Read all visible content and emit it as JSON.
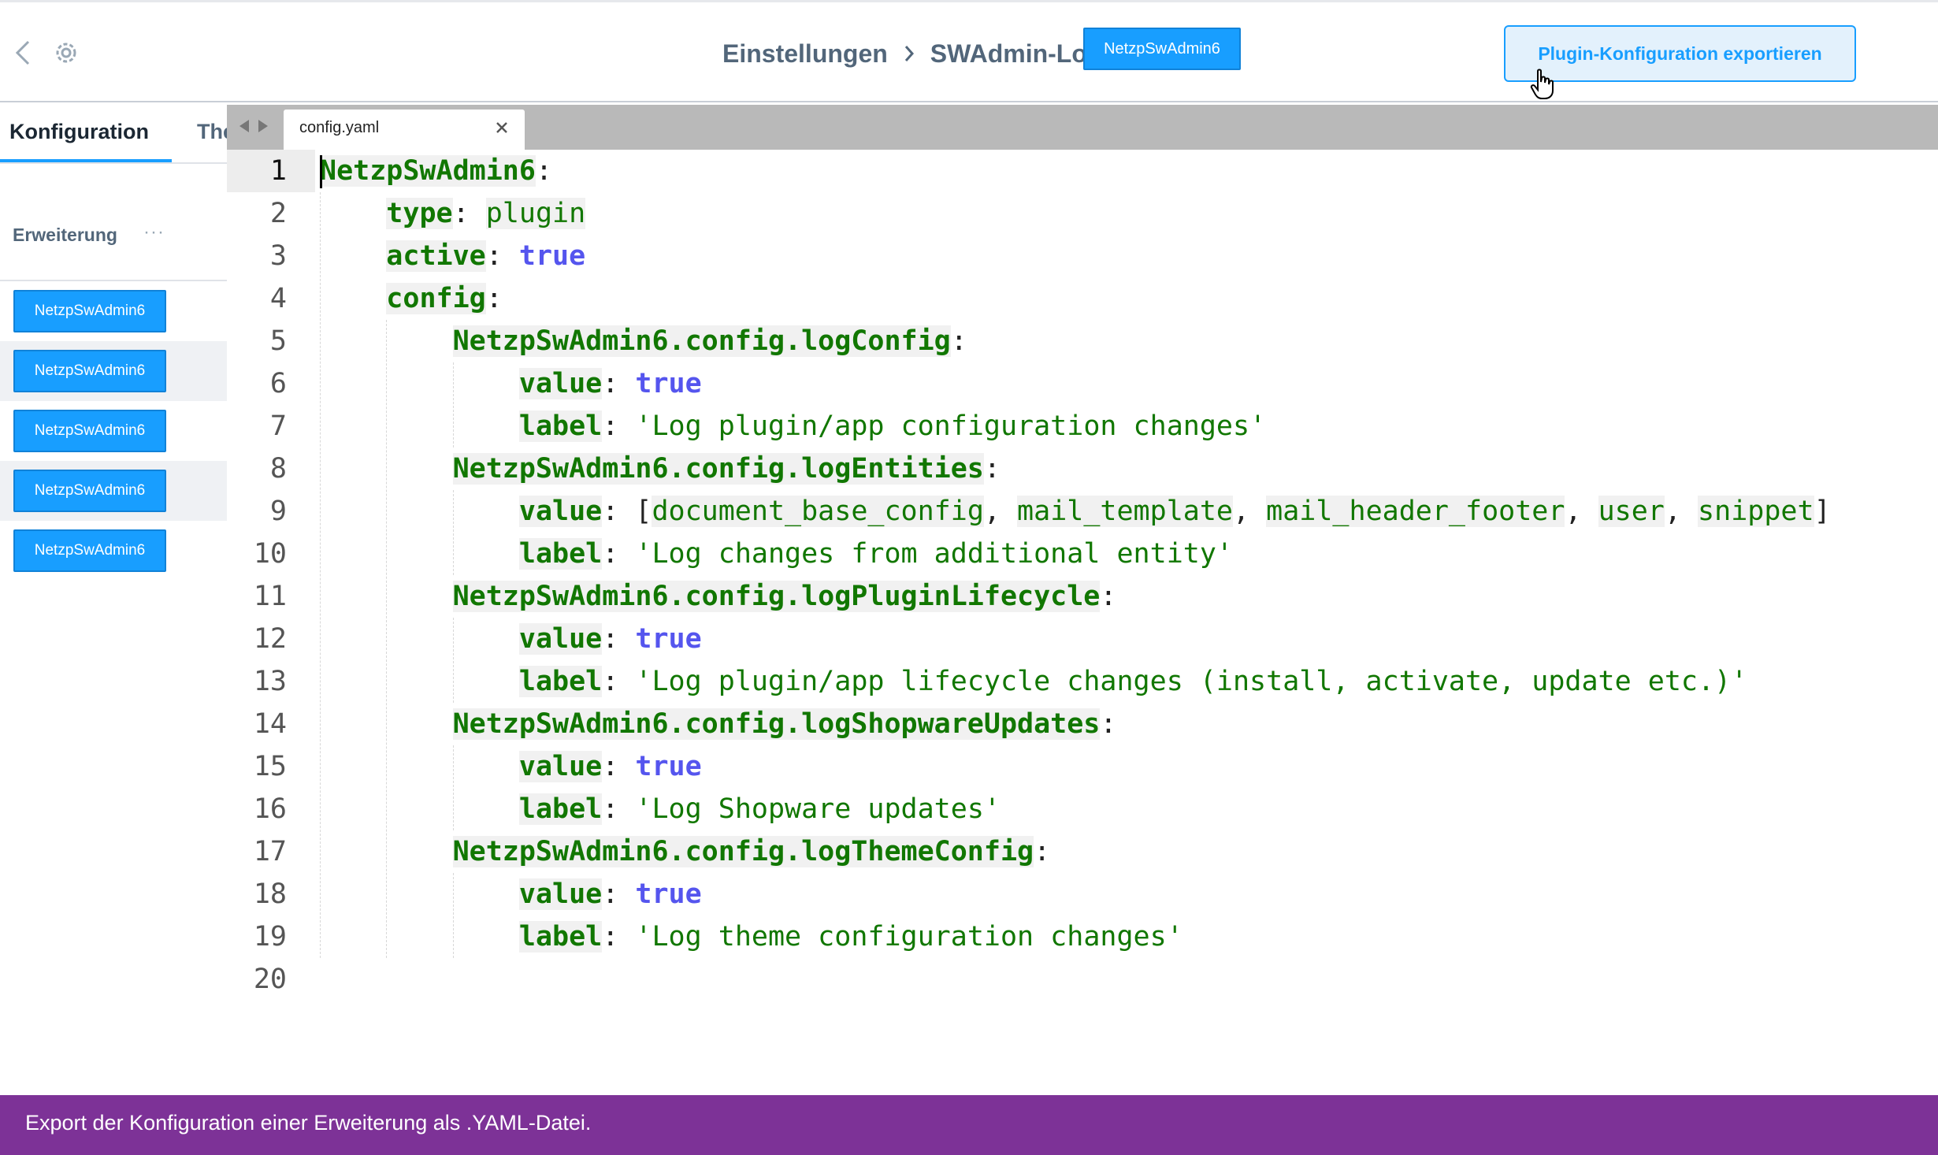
{
  "header": {
    "breadcrumb": [
      "Einstellungen",
      "SWAdmin-Log"
    ],
    "plugin_badge": "NetzpSwAdmin6",
    "export_button": "Plugin-Konfiguration exportieren",
    "accent_color": "#189eff"
  },
  "tabs": [
    {
      "label": "Konfiguration",
      "active": true
    },
    {
      "label": "Theme",
      "active": false
    }
  ],
  "sidebar": {
    "title": "Erweiterung",
    "more": "···",
    "items": [
      "NetzpSwAdmin6",
      "NetzpSwAdmin6",
      "NetzpSwAdmin6",
      "NetzpSwAdmin6",
      "NetzpSwAdmin6"
    ]
  },
  "editor": {
    "file_tab": "config.yaml",
    "close_icon": "close-icon",
    "current_line": 1,
    "line_numbers": [
      "1",
      "2",
      "3",
      "4",
      "5",
      "6",
      "7",
      "8",
      "9",
      "10",
      "11",
      "12",
      "13",
      "14",
      "15",
      "16",
      "17",
      "18",
      "19",
      "20"
    ],
    "lines": [
      [
        {
          "t": "NetzpSwAdmin6",
          "c": "k"
        },
        {
          "t": ":",
          "c": "p"
        }
      ],
      [
        {
          "t": "    ",
          "c": "p"
        },
        {
          "t": "type",
          "c": "k"
        },
        {
          "t": ": ",
          "c": "p"
        },
        {
          "t": "plugin",
          "c": "a"
        }
      ],
      [
        {
          "t": "    ",
          "c": "p"
        },
        {
          "t": "active",
          "c": "k"
        },
        {
          "t": ": ",
          "c": "p"
        },
        {
          "t": "true",
          "c": "b"
        }
      ],
      [
        {
          "t": "    ",
          "c": "p"
        },
        {
          "t": "config",
          "c": "k"
        },
        {
          "t": ":",
          "c": "p"
        }
      ],
      [
        {
          "t": "        ",
          "c": "p"
        },
        {
          "t": "NetzpSwAdmin6.config.logConfig",
          "c": "k"
        },
        {
          "t": ":",
          "c": "p"
        }
      ],
      [
        {
          "t": "            ",
          "c": "p"
        },
        {
          "t": "value",
          "c": "k"
        },
        {
          "t": ": ",
          "c": "p"
        },
        {
          "t": "true",
          "c": "b"
        }
      ],
      [
        {
          "t": "            ",
          "c": "p"
        },
        {
          "t": "label",
          "c": "k"
        },
        {
          "t": ": ",
          "c": "p"
        },
        {
          "t": "'Log plugin/app configuration changes'",
          "c": "s"
        }
      ],
      [
        {
          "t": "        ",
          "c": "p"
        },
        {
          "t": "NetzpSwAdmin6.config.logEntities",
          "c": "k"
        },
        {
          "t": ":",
          "c": "p"
        }
      ],
      [
        {
          "t": "            ",
          "c": "p"
        },
        {
          "t": "value",
          "c": "k"
        },
        {
          "t": ": [",
          "c": "p"
        },
        {
          "t": "document_base_config",
          "c": "a"
        },
        {
          "t": ", ",
          "c": "p"
        },
        {
          "t": "mail_template",
          "c": "a"
        },
        {
          "t": ", ",
          "c": "p"
        },
        {
          "t": "mail_header_footer",
          "c": "a"
        },
        {
          "t": ", ",
          "c": "p"
        },
        {
          "t": "user",
          "c": "a"
        },
        {
          "t": ", ",
          "c": "p"
        },
        {
          "t": "snippet",
          "c": "a"
        },
        {
          "t": "]",
          "c": "p"
        }
      ],
      [
        {
          "t": "            ",
          "c": "p"
        },
        {
          "t": "label",
          "c": "k"
        },
        {
          "t": ": ",
          "c": "p"
        },
        {
          "t": "'Log changes from additional entity'",
          "c": "s"
        }
      ],
      [
        {
          "t": "        ",
          "c": "p"
        },
        {
          "t": "NetzpSwAdmin6.config.logPluginLifecycle",
          "c": "k"
        },
        {
          "t": ":",
          "c": "p"
        }
      ],
      [
        {
          "t": "            ",
          "c": "p"
        },
        {
          "t": "value",
          "c": "k"
        },
        {
          "t": ": ",
          "c": "p"
        },
        {
          "t": "true",
          "c": "b"
        }
      ],
      [
        {
          "t": "            ",
          "c": "p"
        },
        {
          "t": "label",
          "c": "k"
        },
        {
          "t": ": ",
          "c": "p"
        },
        {
          "t": "'Log plugin/app lifecycle changes (install, activate, update etc.)'",
          "c": "s"
        }
      ],
      [
        {
          "t": "        ",
          "c": "p"
        },
        {
          "t": "NetzpSwAdmin6.config.logShopwareUpdates",
          "c": "k"
        },
        {
          "t": ":",
          "c": "p"
        }
      ],
      [
        {
          "t": "            ",
          "c": "p"
        },
        {
          "t": "value",
          "c": "k"
        },
        {
          "t": ": ",
          "c": "p"
        },
        {
          "t": "true",
          "c": "b"
        }
      ],
      [
        {
          "t": "            ",
          "c": "p"
        },
        {
          "t": "label",
          "c": "k"
        },
        {
          "t": ": ",
          "c": "p"
        },
        {
          "t": "'Log Shopware updates'",
          "c": "s"
        }
      ],
      [
        {
          "t": "        ",
          "c": "p"
        },
        {
          "t": "NetzpSwAdmin6.config.logThemeConfig",
          "c": "k"
        },
        {
          "t": ":",
          "c": "p"
        }
      ],
      [
        {
          "t": "            ",
          "c": "p"
        },
        {
          "t": "value",
          "c": "k"
        },
        {
          "t": ": ",
          "c": "p"
        },
        {
          "t": "true",
          "c": "b"
        }
      ],
      [
        {
          "t": "            ",
          "c": "p"
        },
        {
          "t": "label",
          "c": "k"
        },
        {
          "t": ": ",
          "c": "p"
        },
        {
          "t": "'Log theme configuration changes'",
          "c": "s"
        }
      ],
      []
    ]
  },
  "footer": {
    "text": "Export der Konfiguration einer Erweiterung als .YAML-Datei.",
    "color": "#7d3297"
  }
}
